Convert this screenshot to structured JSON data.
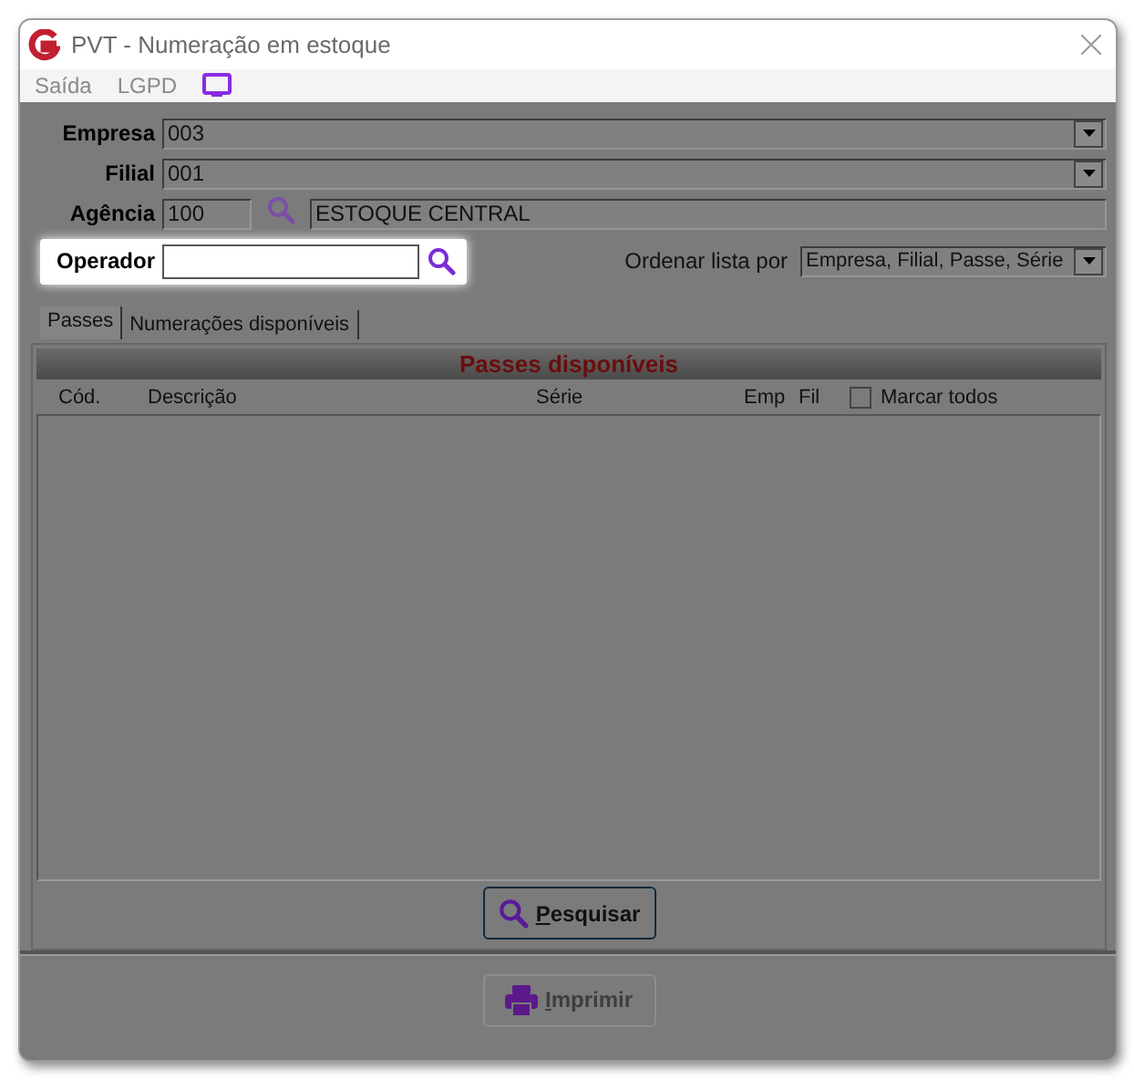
{
  "window": {
    "title": "PVT - Numeração em estoque"
  },
  "menu": [
    "Saída",
    "LGPD"
  ],
  "fields": [
    {
      "label": "Empresa",
      "value": "003",
      "kind": "combo"
    },
    {
      "label": "Filial",
      "value": "001",
      "kind": "combo"
    },
    {
      "label": "Agência",
      "value": "100",
      "kind": "lookup",
      "description": "ESTOQUE CENTRAL"
    }
  ],
  "operator": {
    "label": "Operador"
  },
  "sort": {
    "label": "Ordenar lista por",
    "value": "Empresa, Filial, Passe, Série"
  },
  "tabs": [
    {
      "label": "Passes",
      "selected": true
    },
    {
      "label": "Numerações disponíveis",
      "selected": false
    }
  ],
  "panel": {
    "title": "Passes disponíveis",
    "columns": [
      "Cód.",
      "Descrição",
      "Série",
      "Emp",
      "Fil"
    ],
    "select_all": {
      "label": "Marcar todos",
      "checked": false
    }
  },
  "buttons": [
    {
      "label": "Pesquisar",
      "kind": "search",
      "disabled": false
    },
    {
      "label": "Imprimir",
      "kind": "print",
      "disabled": true
    }
  ]
}
